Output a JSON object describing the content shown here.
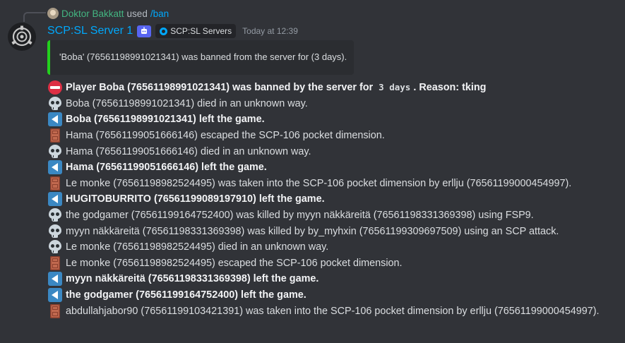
{
  "reply": {
    "user": "Doktor Bakkatt",
    "used_text": "used",
    "command": "/ban"
  },
  "message": {
    "author": "SCP:SL Server 1",
    "server_tag": "SCP:SL Servers",
    "timestamp": "Today at 12:39",
    "embed_color": "#23d11d",
    "embed_text": "'Boba' (76561198991021341) was banned from the server for (3 days)."
  },
  "log_lines": [
    {
      "icon": "no-entry-icon",
      "bold": true,
      "before": "Player Boba (76561198991021341) was banned by the server for",
      "code": "3 days",
      "after": ". Reason: tking"
    },
    {
      "icon": "skull-icon",
      "bold": false,
      "text": "Boba (76561198991021341) died in an unknown way."
    },
    {
      "icon": "back-arrow-icon",
      "bold": true,
      "text": "Boba (76561198991021341) left the game."
    },
    {
      "icon": "door-icon",
      "bold": false,
      "text": "Hama (76561199051666146) escaped the SCP-106 pocket dimension."
    },
    {
      "icon": "skull-icon",
      "bold": false,
      "text": "Hama (76561199051666146) died in an unknown way."
    },
    {
      "icon": "back-arrow-icon",
      "bold": true,
      "text": "Hama (76561199051666146) left the game."
    },
    {
      "icon": "door-icon",
      "bold": false,
      "text": "Le monke (76561198982524495) was taken into the SCP-106 pocket dimension by erllju (76561199000454997)."
    },
    {
      "icon": "back-arrow-icon",
      "bold": true,
      "text": "HUGITOBURRITO (76561199089197910) left the game."
    },
    {
      "icon": "skull-icon",
      "bold": false,
      "text": "the godgamer (76561199164752400) was killed by myyn näkkäreitä (76561198331369398) using FSP9."
    },
    {
      "icon": "skull-icon",
      "bold": false,
      "text": "myyn näkkäreitä (76561198331369398) was killed by by_myhxin (76561199309697509) using an SCP attack."
    },
    {
      "icon": "skull-icon",
      "bold": false,
      "text": "Le monke (76561198982524495) died in an unknown way."
    },
    {
      "icon": "door-icon",
      "bold": false,
      "text": "Le monke (76561198982524495) escaped the SCP-106 pocket dimension."
    },
    {
      "icon": "back-arrow-icon",
      "bold": true,
      "text": "myyn näkkäreitä (76561198331369398) left the game."
    },
    {
      "icon": "back-arrow-icon",
      "bold": true,
      "text": "the godgamer (76561199164752400) left the game."
    },
    {
      "icon": "door-icon",
      "bold": false,
      "text": "abdullahjabor90 (76561199103421391) was taken into the SCP-106 pocket dimension by erllju (76561199000454997)."
    }
  ]
}
